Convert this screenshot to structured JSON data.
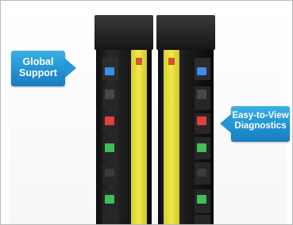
{
  "callouts": {
    "global_support": {
      "line1": "Global",
      "line2": "Support"
    },
    "diagnostics": {
      "line1": "Easy-to-View",
      "line2": "Diagnostics"
    }
  },
  "colors": {
    "callout_blue": "#1f8fd1",
    "sensor_housing": "#1e1e1e",
    "label_strip": "#ece33a",
    "led_blue": "#3a8fe8",
    "led_red": "#e0403a",
    "led_green": "#3fbf55"
  }
}
